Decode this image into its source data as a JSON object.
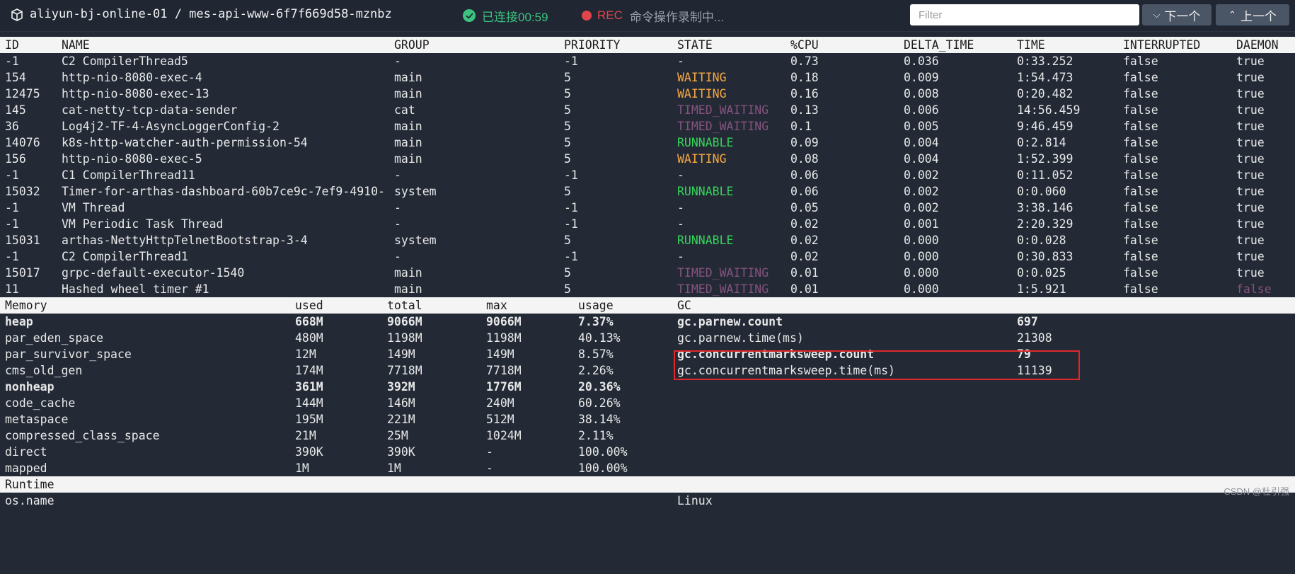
{
  "topbar": {
    "connection_title": "aliyun-bj-online-01 / mes-api-www-6f7f669d58-mznbz",
    "status_text": "已连接00:59",
    "rec_label": "REC",
    "rec_message": "命令操作录制中...",
    "filter_placeholder": "Filter",
    "next_label": "下一个",
    "prev_label": "上一个",
    "status_color": "#3cc380",
    "rec_color": "#e0454a"
  },
  "threads": {
    "headers": [
      "ID",
      "NAME",
      "GROUP",
      "PRIORITY",
      "STATE",
      "%CPU",
      "DELTA_TIME",
      "TIME",
      "INTERRUPTED",
      "DAEMON"
    ],
    "rows": [
      {
        "id": "-1",
        "name": "C2 CompilerThread5",
        "group": "-",
        "priority": "-1",
        "state": "-",
        "cpu": "0.73",
        "delta": "0.036",
        "time": "0:33.252",
        "interrupted": "false",
        "daemon": "true"
      },
      {
        "id": "154",
        "name": "http-nio-8080-exec-4",
        "group": "main",
        "priority": "5",
        "state": "WAITING",
        "cpu": "0.18",
        "delta": "0.009",
        "time": "1:54.473",
        "interrupted": "false",
        "daemon": "true"
      },
      {
        "id": "12475",
        "name": "http-nio-8080-exec-13",
        "group": "main",
        "priority": "5",
        "state": "WAITING",
        "cpu": "0.16",
        "delta": "0.008",
        "time": "0:20.482",
        "interrupted": "false",
        "daemon": "true"
      },
      {
        "id": "145",
        "name": "cat-netty-tcp-data-sender",
        "group": "cat",
        "priority": "5",
        "state": "TIMED_WAITING",
        "cpu": "0.13",
        "delta": "0.006",
        "time": "14:56.459",
        "interrupted": "false",
        "daemon": "true"
      },
      {
        "id": "36",
        "name": "Log4j2-TF-4-AsyncLoggerConfig-2",
        "group": "main",
        "priority": "5",
        "state": "TIMED_WAITING",
        "cpu": "0.1",
        "delta": "0.005",
        "time": "9:46.459",
        "interrupted": "false",
        "daemon": "true"
      },
      {
        "id": "14076",
        "name": "k8s-http-watcher-auth-permission-54",
        "group": "main",
        "priority": "5",
        "state": "RUNNABLE",
        "cpu": "0.09",
        "delta": "0.004",
        "time": "0:2.814",
        "interrupted": "false",
        "daemon": "true"
      },
      {
        "id": "156",
        "name": "http-nio-8080-exec-5",
        "group": "main",
        "priority": "5",
        "state": "WAITING",
        "cpu": "0.08",
        "delta": "0.004",
        "time": "1:52.399",
        "interrupted": "false",
        "daemon": "true"
      },
      {
        "id": "-1",
        "name": "C1 CompilerThread11",
        "group": "-",
        "priority": "-1",
        "state": "-",
        "cpu": "0.06",
        "delta": "0.002",
        "time": "0:11.052",
        "interrupted": "false",
        "daemon": "true"
      },
      {
        "id": "15032",
        "name": "Timer-for-arthas-dashboard-60b7ce9c-7ef9-4910-",
        "group": "system",
        "priority": "5",
        "state": "RUNNABLE",
        "cpu": "0.06",
        "delta": "0.002",
        "time": "0:0.060",
        "interrupted": "false",
        "daemon": "true"
      },
      {
        "id": "-1",
        "name": "VM Thread",
        "group": "-",
        "priority": "-1",
        "state": "-",
        "cpu": "0.05",
        "delta": "0.002",
        "time": "3:38.146",
        "interrupted": "false",
        "daemon": "true"
      },
      {
        "id": "-1",
        "name": "VM Periodic Task Thread",
        "group": "-",
        "priority": "-1",
        "state": "-",
        "cpu": "0.02",
        "delta": "0.001",
        "time": "2:20.329",
        "interrupted": "false",
        "daemon": "true"
      },
      {
        "id": "15031",
        "name": "arthas-NettyHttpTelnetBootstrap-3-4",
        "group": "system",
        "priority": "5",
        "state": "RUNNABLE",
        "cpu": "0.02",
        "delta": "0.000",
        "time": "0:0.028",
        "interrupted": "false",
        "daemon": "true"
      },
      {
        "id": "-1",
        "name": "C2 CompilerThread1",
        "group": "-",
        "priority": "-1",
        "state": "-",
        "cpu": "0.02",
        "delta": "0.000",
        "time": "0:30.833",
        "interrupted": "false",
        "daemon": "true"
      },
      {
        "id": "15017",
        "name": "grpc-default-executor-1540",
        "group": "main",
        "priority": "5",
        "state": "TIMED_WAITING",
        "cpu": "0.01",
        "delta": "0.000",
        "time": "0:0.025",
        "interrupted": "false",
        "daemon": "true"
      },
      {
        "id": "11",
        "name": "Hashed wheel timer #1",
        "group": "main",
        "priority": "5",
        "state": "TIMED_WAITING",
        "cpu": "0.01",
        "delta": "0.000",
        "time": "1:5.921",
        "interrupted": "false",
        "daemon": "false"
      }
    ]
  },
  "memory": {
    "headers": [
      "Memory",
      "used",
      "total",
      "max",
      "usage"
    ],
    "rows": [
      {
        "name": "heap",
        "used": "668M",
        "total": "9066M",
        "max": "9066M",
        "usage": "7.37%",
        "bold": true
      },
      {
        "name": "par_eden_space",
        "used": "480M",
        "total": "1198M",
        "max": "1198M",
        "usage": "40.13%"
      },
      {
        "name": "par_survivor_space",
        "used": "12M",
        "total": "149M",
        "max": "149M",
        "usage": "8.57%"
      },
      {
        "name": "cms_old_gen",
        "used": "174M",
        "total": "7718M",
        "max": "7718M",
        "usage": "2.26%"
      },
      {
        "name": "nonheap",
        "used": "361M",
        "total": "392M",
        "max": "1776M",
        "usage": "20.36%",
        "bold": true
      },
      {
        "name": "code_cache",
        "used": "144M",
        "total": "146M",
        "max": "240M",
        "usage": "60.26%"
      },
      {
        "name": "metaspace",
        "used": "195M",
        "total": "221M",
        "max": "512M",
        "usage": "38.14%"
      },
      {
        "name": "compressed_class_space",
        "used": "21M",
        "total": "25M",
        "max": "1024M",
        "usage": "2.11%"
      },
      {
        "name": "direct",
        "used": "390K",
        "total": "390K",
        "max": "-",
        "usage": "100.00%"
      },
      {
        "name": "mapped",
        "used": "1M",
        "total": "1M",
        "max": "-",
        "usage": "100.00%"
      }
    ]
  },
  "gc": {
    "header": "GC",
    "rows": [
      {
        "name": "gc.parnew.count",
        "value": "697",
        "bold": true
      },
      {
        "name": "gc.parnew.time(ms)",
        "value": "21308"
      },
      {
        "name": "gc.concurrentmarksweep.count",
        "value": "79",
        "bold": true
      },
      {
        "name": "gc.concurrentmarksweep.time(ms)",
        "value": "11139"
      }
    ]
  },
  "runtime": {
    "header": "Runtime",
    "partial_left": "os.name",
    "partial_right": "Linux"
  },
  "watermark": "CSDN @杜引强",
  "colors": {
    "waiting": "#f5a742",
    "timed_waiting": "#86527e",
    "runnable": "#37d35a",
    "highlight_box": "#e0282a"
  }
}
